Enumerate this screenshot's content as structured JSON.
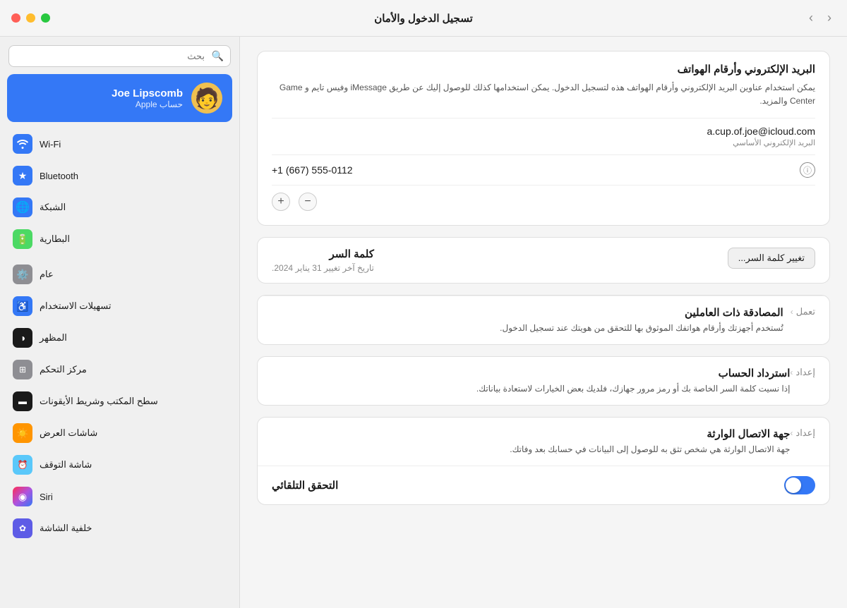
{
  "titlebar": {
    "title": "تسجيل الدخول والأمان",
    "back_btn": "‹",
    "forward_btn": "›"
  },
  "sidebar": {
    "search_placeholder": "بحث",
    "profile": {
      "name": "Joe Lipscomb",
      "subtitle": "حساب Apple",
      "avatar_emoji": "🧑"
    },
    "items": [
      {
        "id": "wifi",
        "label": "Wi-Fi",
        "icon": "📶",
        "icon_class": "icon-wifi"
      },
      {
        "id": "bluetooth",
        "label": "Bluetooth",
        "icon": "⬡",
        "icon_class": "icon-bluetooth"
      },
      {
        "id": "network",
        "label": "الشبكة",
        "icon": "🌐",
        "icon_class": "icon-network"
      },
      {
        "id": "battery",
        "label": "البطارية",
        "icon": "🔋",
        "icon_class": "icon-battery"
      },
      {
        "id": "general",
        "label": "عام",
        "icon": "⚙",
        "icon_class": "icon-general"
      },
      {
        "id": "accessibility",
        "label": "تسهيلات الاستخدام",
        "icon": "♿",
        "icon_class": "icon-accessibility"
      },
      {
        "id": "display",
        "label": "المظهر",
        "icon": "◑",
        "icon_class": "icon-display"
      },
      {
        "id": "controlcenter",
        "label": "مركز التحكم",
        "icon": "▤",
        "icon_class": "icon-controlcenter"
      },
      {
        "id": "desktop",
        "label": "سطح المكتب وشريط الأيقونات",
        "icon": "⬛",
        "icon_class": "icon-desktop"
      },
      {
        "id": "screensavers",
        "label": "شاشات العرض",
        "icon": "☀",
        "icon_class": "icon-screensavers"
      },
      {
        "id": "screensaver",
        "label": "شاشة التوقف",
        "icon": "⏰",
        "icon_class": "icon-screensaver"
      },
      {
        "id": "siri",
        "label": "Siri",
        "icon": "◉",
        "icon_class": "icon-siri"
      },
      {
        "id": "wallpaper",
        "label": "خلفية الشاشة",
        "icon": "✿",
        "icon_class": "icon-wallpaper"
      }
    ]
  },
  "content": {
    "email_section": {
      "title": "البريد الإلكتروني وأرقام الهواتف",
      "description": "يمكن استخدام عناوين البريد الإلكتروني وأرقام الهواتف هذه لتسجيل الدخول. يمكن استخدامها كذلك للوصول إليك عن طريق iMessage وفيس تايم و Game Center والمزيد.",
      "email": "a.cup.of.joe@icloud.com",
      "email_label": "البريد الإلكتروني الأساسي",
      "phone": "+1 (667) 555-0112"
    },
    "password_section": {
      "title": "كلمة السر",
      "subtitle": "تاريخ آخر تغيير 31 يناير 2024.",
      "change_btn": "تغيير كلمة السر..."
    },
    "twofactor_section": {
      "title": "المصادقة ذات العاملين",
      "description": "تُستخدم أجهزتك وأرقام هواتفك الموثوق بها للتحقق من هويتك عند تسجيل الدخول.",
      "status": "تعمل"
    },
    "recovery_section": {
      "title": "استرداد الحساب",
      "description": "إذا نسيت كلمة السر الخاصة بك أو رمز مرور جهازك، فلديك بعض الخيارات لاستعادة بياناتك.",
      "btn_label": "إعداد"
    },
    "legacy_section": {
      "title": "جهة الاتصال الوارثة",
      "description": "جهة الاتصال الوارثة هي شخص تثق به للوصول إلى البيانات في حسابك بعد وفاتك.",
      "btn_label": "إعداد"
    },
    "autologin_section": {
      "title": "التحقق التلقائي"
    }
  }
}
